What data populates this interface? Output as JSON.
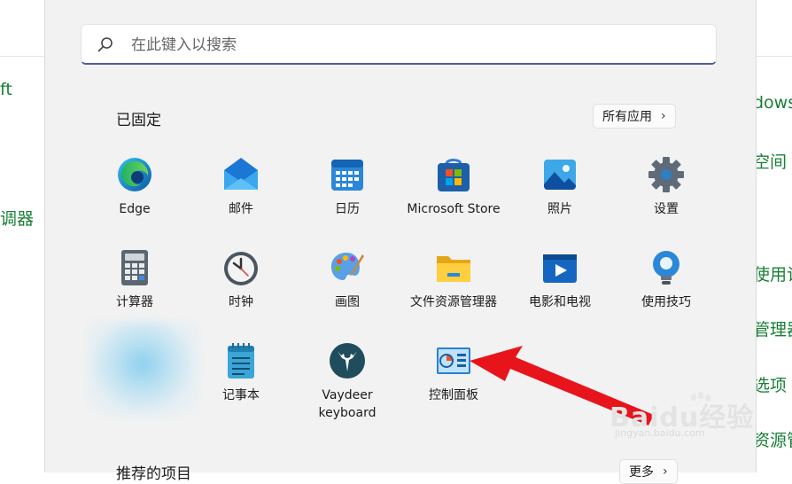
{
  "background": {
    "left_fragments": [
      "ft",
      "调器"
    ],
    "right_fragments": [
      "dows",
      "空间",
      "使用记",
      "管理器",
      "选项",
      "资源管"
    ]
  },
  "start_menu": {
    "search": {
      "placeholder": "在此键入以搜索"
    },
    "pinned": {
      "title": "已固定",
      "all_apps_label": "所有应用",
      "apps": [
        {
          "name": "edge",
          "label": "Edge"
        },
        {
          "name": "mail",
          "label": "邮件"
        },
        {
          "name": "calendar",
          "label": "日历"
        },
        {
          "name": "microsoft-store",
          "label": "Microsoft Store"
        },
        {
          "name": "photos",
          "label": "照片"
        },
        {
          "name": "settings",
          "label": "设置"
        },
        {
          "name": "calculator",
          "label": "计算器"
        },
        {
          "name": "clock",
          "label": "时钟"
        },
        {
          "name": "paint",
          "label": "画图"
        },
        {
          "name": "file-explorer",
          "label": "文件资源管理器"
        },
        {
          "name": "movies-tv",
          "label": "电影和电视"
        },
        {
          "name": "tips",
          "label": "使用技巧"
        },
        {
          "name": "notepad",
          "label": "记事本"
        },
        {
          "name": "vaydeer-keyboard",
          "label": "Vaydeer keyboard"
        },
        {
          "name": "control-panel",
          "label": "控制面板"
        }
      ]
    },
    "recommended": {
      "title": "推荐的项目",
      "more_label": "更多"
    }
  },
  "watermark": {
    "brand": "Baidu经验",
    "url": "jingyan.baidu.com"
  },
  "colors": {
    "accent": "#4f5ba8",
    "arrow": "#e8141b",
    "bg_link": "#1a7f37"
  }
}
